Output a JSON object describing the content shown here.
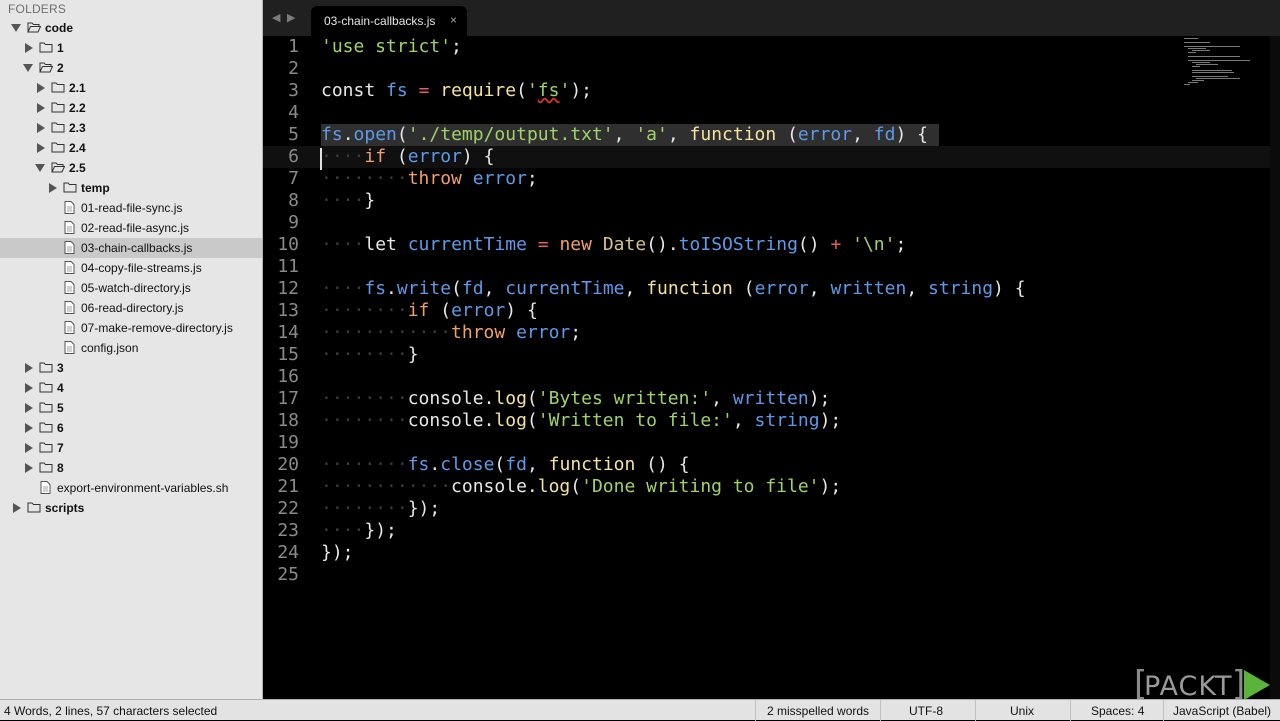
{
  "sidebar": {
    "header": "FOLDERS",
    "tree": [
      {
        "label": "code",
        "type": "folder",
        "open": true,
        "depth": 0,
        "bold": true
      },
      {
        "label": "1",
        "type": "folder",
        "open": false,
        "depth": 1,
        "bold": true
      },
      {
        "label": "2",
        "type": "folder",
        "open": true,
        "depth": 1,
        "bold": true
      },
      {
        "label": "2.1",
        "type": "folder",
        "open": false,
        "depth": 2,
        "bold": true
      },
      {
        "label": "2.2",
        "type": "folder",
        "open": false,
        "depth": 2,
        "bold": true
      },
      {
        "label": "2.3",
        "type": "folder",
        "open": false,
        "depth": 2,
        "bold": true
      },
      {
        "label": "2.4",
        "type": "folder",
        "open": false,
        "depth": 2,
        "bold": true
      },
      {
        "label": "2.5",
        "type": "folder",
        "open": true,
        "depth": 2,
        "bold": true
      },
      {
        "label": "temp",
        "type": "folder",
        "open": false,
        "depth": 3,
        "bold": true
      },
      {
        "label": "01-read-file-sync.js",
        "type": "file",
        "depth": 3
      },
      {
        "label": "02-read-file-async.js",
        "type": "file",
        "depth": 3
      },
      {
        "label": "03-chain-callbacks.js",
        "type": "file",
        "depth": 3,
        "selected": true
      },
      {
        "label": "04-copy-file-streams.js",
        "type": "file",
        "depth": 3
      },
      {
        "label": "05-watch-directory.js",
        "type": "file",
        "depth": 3
      },
      {
        "label": "06-read-directory.js",
        "type": "file",
        "depth": 3
      },
      {
        "label": "07-make-remove-directory.js",
        "type": "file",
        "depth": 3
      },
      {
        "label": "config.json",
        "type": "file",
        "depth": 3
      },
      {
        "label": "3",
        "type": "folder",
        "open": false,
        "depth": 1,
        "bold": true
      },
      {
        "label": "4",
        "type": "folder",
        "open": false,
        "depth": 1,
        "bold": true
      },
      {
        "label": "5",
        "type": "folder",
        "open": false,
        "depth": 1,
        "bold": true
      },
      {
        "label": "6",
        "type": "folder",
        "open": false,
        "depth": 1,
        "bold": true
      },
      {
        "label": "7",
        "type": "folder",
        "open": false,
        "depth": 1,
        "bold": true
      },
      {
        "label": "8",
        "type": "folder",
        "open": false,
        "depth": 1,
        "bold": true
      },
      {
        "label": "export-environment-variables.sh",
        "type": "file",
        "depth": 1
      },
      {
        "label": "scripts",
        "type": "folder",
        "open": false,
        "depth": 0,
        "bold": true
      }
    ]
  },
  "tabs": {
    "nav_prev": "◀",
    "nav_next": "▶",
    "active_label": "03-chain-callbacks.js",
    "close_glyph": "×"
  },
  "editor": {
    "lines": [
      [
        [
          "'use strict'",
          "c-str"
        ],
        [
          ";",
          "c-plain"
        ]
      ],
      [],
      [
        [
          "const ",
          "c-plain"
        ],
        [
          "fs",
          "c-var"
        ],
        [
          " ",
          "c-plain"
        ],
        [
          "=",
          "c-op"
        ],
        [
          " ",
          "c-plain"
        ],
        [
          "require",
          "c-fn"
        ],
        [
          "(",
          "c-plain"
        ],
        [
          "'",
          "c-str"
        ],
        [
          "fs",
          "c-str misspell"
        ],
        [
          "'",
          "c-str"
        ],
        [
          ");",
          "c-plain"
        ]
      ],
      [],
      [
        [
          "fs",
          "c-var"
        ],
        [
          ".",
          "c-plain"
        ],
        [
          "open",
          "c-meth"
        ],
        [
          "(",
          "c-plain"
        ],
        [
          "'./temp/output.txt'",
          "c-str"
        ],
        [
          ", ",
          "c-plain"
        ],
        [
          "'a'",
          "c-str"
        ],
        [
          ", ",
          "c-plain"
        ],
        [
          "function",
          "c-fn"
        ],
        [
          " (",
          "c-plain"
        ],
        [
          "error",
          "c-var"
        ],
        [
          ", ",
          "c-plain"
        ],
        [
          "fd",
          "c-var"
        ],
        [
          ") {",
          "c-plain"
        ]
      ],
      [
        [
          "····",
          "ws"
        ],
        [
          "if",
          "c-kw"
        ],
        [
          " (",
          "c-plain"
        ],
        [
          "error",
          "c-var"
        ],
        [
          ") {",
          "c-plain"
        ]
      ],
      [
        [
          "········",
          "ws"
        ],
        [
          "throw",
          "c-kw"
        ],
        [
          " ",
          "c-plain"
        ],
        [
          "error",
          "c-var"
        ],
        [
          ";",
          "c-plain"
        ]
      ],
      [
        [
          "····",
          "ws"
        ],
        [
          "}",
          "c-plain"
        ]
      ],
      [],
      [
        [
          "····",
          "ws"
        ],
        [
          "let ",
          "c-plain"
        ],
        [
          "currentTime",
          "c-var"
        ],
        [
          " ",
          "c-plain"
        ],
        [
          "=",
          "c-op"
        ],
        [
          " ",
          "c-plain"
        ],
        [
          "new",
          "c-kw"
        ],
        [
          " ",
          "c-plain"
        ],
        [
          "Date",
          "c-cls"
        ],
        [
          "().",
          "c-plain"
        ],
        [
          "toISOString",
          "c-meth"
        ],
        [
          "() ",
          "c-plain"
        ],
        [
          "+",
          "c-op"
        ],
        [
          " ",
          "c-plain"
        ],
        [
          "'\\n'",
          "c-str"
        ],
        [
          ";",
          "c-plain"
        ]
      ],
      [],
      [
        [
          "····",
          "ws"
        ],
        [
          "fs",
          "c-var"
        ],
        [
          ".",
          "c-plain"
        ],
        [
          "write",
          "c-meth"
        ],
        [
          "(",
          "c-plain"
        ],
        [
          "fd",
          "c-var"
        ],
        [
          ", ",
          "c-plain"
        ],
        [
          "currentTime",
          "c-var"
        ],
        [
          ", ",
          "c-plain"
        ],
        [
          "function",
          "c-fn"
        ],
        [
          " (",
          "c-plain"
        ],
        [
          "error",
          "c-var"
        ],
        [
          ", ",
          "c-plain"
        ],
        [
          "written",
          "c-var"
        ],
        [
          ", ",
          "c-plain"
        ],
        [
          "string",
          "c-var"
        ],
        [
          ") {",
          "c-plain"
        ]
      ],
      [
        [
          "········",
          "ws"
        ],
        [
          "if",
          "c-kw"
        ],
        [
          " (",
          "c-plain"
        ],
        [
          "error",
          "c-var"
        ],
        [
          ") {",
          "c-plain"
        ]
      ],
      [
        [
          "············",
          "ws"
        ],
        [
          "throw",
          "c-kw"
        ],
        [
          " ",
          "c-plain"
        ],
        [
          "error",
          "c-var"
        ],
        [
          ";",
          "c-plain"
        ]
      ],
      [
        [
          "········",
          "ws"
        ],
        [
          "}",
          "c-plain"
        ]
      ],
      [],
      [
        [
          "········",
          "ws"
        ],
        [
          "console",
          "c-plain"
        ],
        [
          ".",
          "c-plain"
        ],
        [
          "log",
          "c-fn"
        ],
        [
          "(",
          "c-plain"
        ],
        [
          "'Bytes written:'",
          "c-str"
        ],
        [
          ", ",
          "c-plain"
        ],
        [
          "written",
          "c-var"
        ],
        [
          ");",
          "c-plain"
        ]
      ],
      [
        [
          "········",
          "ws"
        ],
        [
          "console",
          "c-plain"
        ],
        [
          ".",
          "c-plain"
        ],
        [
          "log",
          "c-fn"
        ],
        [
          "(",
          "c-plain"
        ],
        [
          "'Written to file:'",
          "c-str"
        ],
        [
          ", ",
          "c-plain"
        ],
        [
          "string",
          "c-var"
        ],
        [
          ");",
          "c-plain"
        ]
      ],
      [],
      [
        [
          "········",
          "ws"
        ],
        [
          "fs",
          "c-var"
        ],
        [
          ".",
          "c-plain"
        ],
        [
          "close",
          "c-meth"
        ],
        [
          "(",
          "c-plain"
        ],
        [
          "fd",
          "c-var"
        ],
        [
          ", ",
          "c-plain"
        ],
        [
          "function",
          "c-fn"
        ],
        [
          " () {",
          "c-plain"
        ]
      ],
      [
        [
          "············",
          "ws"
        ],
        [
          "console",
          "c-plain"
        ],
        [
          ".",
          "c-plain"
        ],
        [
          "log",
          "c-fn"
        ],
        [
          "(",
          "c-plain"
        ],
        [
          "'Done writing to file'",
          "c-str"
        ],
        [
          ");",
          "c-plain"
        ]
      ],
      [
        [
          "········",
          "ws"
        ],
        [
          "});",
          "c-plain"
        ]
      ],
      [
        [
          "····",
          "ws"
        ],
        [
          "});",
          "c-plain"
        ]
      ],
      [
        [
          "});",
          "c-plain"
        ]
      ],
      []
    ]
  },
  "watermark": {
    "left_bracket": "[",
    "text": "PACKT",
    "right_bracket": "]",
    "accent": "#5ab33a"
  },
  "statusbar": {
    "selection_info": "4 Words, 2 lines, 57 characters selected",
    "spelling": "2 misspelled words",
    "encoding": "UTF-8",
    "line_endings": "Unix",
    "indentation": "Spaces: 4",
    "syntax": "JavaScript (Babel)"
  }
}
